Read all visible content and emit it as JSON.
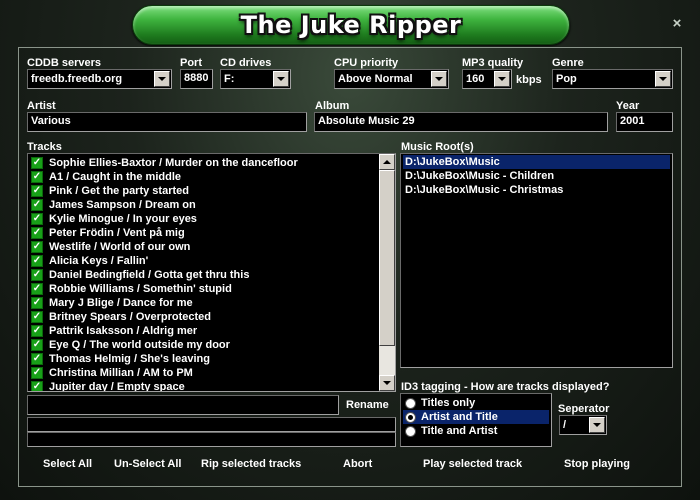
{
  "window": {
    "title": "The Juke Ripper",
    "close": "×"
  },
  "labels": {
    "cddb_servers": "CDDB servers",
    "port": "Port",
    "cd_drives": "CD drives",
    "cpu_priority": "CPU priority",
    "mp3_quality": "MP3 quality",
    "kbps": "kbps",
    "genre": "Genre",
    "artist": "Artist",
    "album": "Album",
    "year": "Year",
    "tracks": "Tracks",
    "music_roots": "Music Root(s)",
    "id3_tagging": "ID3 tagging - How are tracks displayed?",
    "separator": "Seperator"
  },
  "fields": {
    "cddb_server": "freedb.freedb.org",
    "port": "8880",
    "cd_drive": "F:",
    "cpu_priority": "Above Normal",
    "mp3_quality": "160",
    "genre": "Pop",
    "artist": "Various",
    "album": "Absolute Music 29",
    "year": "2001",
    "rename": "",
    "separator": "/"
  },
  "tracks": [
    "Sophie Ellies-Baxtor / Murder on the dancefloor",
    "A1 / Caught in the middle",
    "Pink / Get the party started",
    "James Sampson / Dream on",
    "Kylie Minogue / In your eyes",
    "Peter Frödin / Vent på mig",
    "Westlife / World of our own",
    "Alicia Keys / Fallin'",
    "Daniel Bedingfield / Gotta get thru this",
    "Robbie Williams / Somethin' stupid",
    "Mary J Blige / Dance for me",
    "Britney Spears / Overprotected",
    "Pattrik Isaksson / Aldrig mer",
    "Eye Q / The world outside my door",
    "Thomas Helmig / She's leaving",
    "Christina  Millian / AM to PM",
    "Jupiter day / Empty space"
  ],
  "music_roots": [
    "D:\\JukeBox\\Music",
    "D:\\JukeBox\\Music - Children",
    "D:\\JukeBox\\Music - Christmas"
  ],
  "id3_options": [
    "Titles only",
    "Artist and Title",
    "Title and Artist"
  ],
  "id3_selected_index": 1,
  "buttons": {
    "rename": "Rename",
    "select_all": "Select All",
    "unselect_all": "Un-Select All",
    "rip_selected": "Rip selected tracks",
    "abort": "Abort",
    "play_selected": "Play selected track",
    "stop_playing": "Stop playing"
  },
  "icons": {
    "close": "close-icon",
    "dropdown": "chevron-down-icon",
    "checkbox": "checkbox-checked-icon",
    "scroll_up": "scroll-up-icon",
    "scroll_down": "scroll-down-icon",
    "radio": "radio-icon"
  },
  "colors": {
    "title_pill": "#2f9a2f",
    "selection": "#0a246a",
    "checkbox": "#18a018",
    "background": "#1c231c"
  }
}
